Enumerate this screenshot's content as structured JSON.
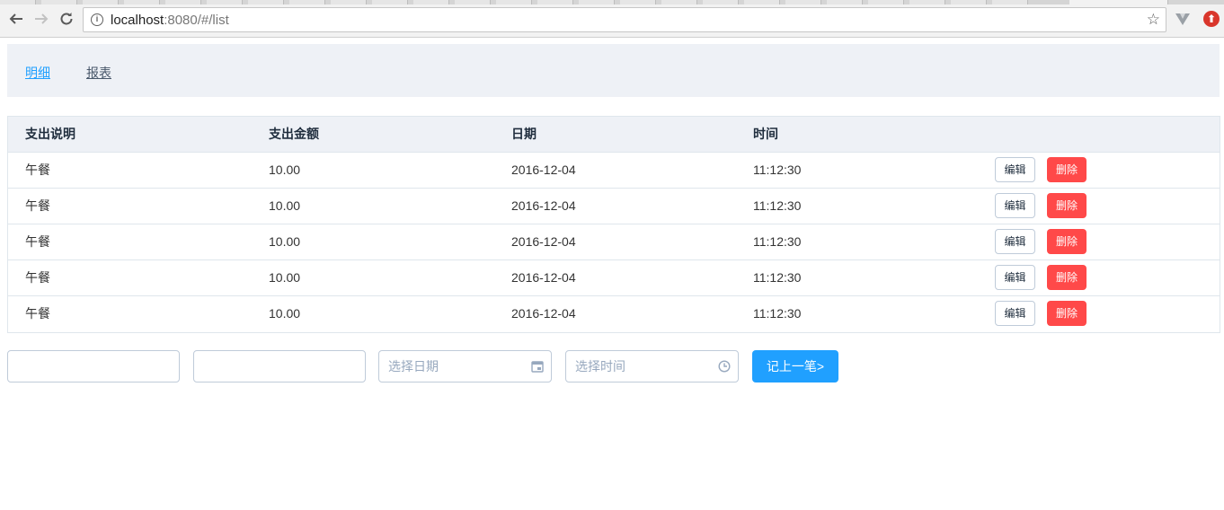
{
  "browser": {
    "url_host": "localhost",
    "url_rest": ":8080/#/list"
  },
  "nav": {
    "detail": "明细",
    "report": "报表"
  },
  "table": {
    "headers": [
      "支出说明",
      "支出金额",
      "日期",
      "时间"
    ],
    "rows": [
      {
        "desc": "午餐",
        "amount": "10.00",
        "date": "2016-12-04",
        "time": "11:12:30"
      },
      {
        "desc": "午餐",
        "amount": "10.00",
        "date": "2016-12-04",
        "time": "11:12:30"
      },
      {
        "desc": "午餐",
        "amount": "10.00",
        "date": "2016-12-04",
        "time": "11:12:30"
      },
      {
        "desc": "午餐",
        "amount": "10.00",
        "date": "2016-12-04",
        "time": "11:12:30"
      },
      {
        "desc": "午餐",
        "amount": "10.00",
        "date": "2016-12-04",
        "time": "11:12:30"
      }
    ],
    "edit_label": "编辑",
    "delete_label": "删除"
  },
  "form": {
    "desc_value": "",
    "amount_value": "",
    "date_placeholder": "选择日期",
    "time_placeholder": "选择时间",
    "submit_label": "记上一笔>"
  },
  "colors": {
    "primary": "#20a0ff",
    "danger": "#ff4949",
    "header_bg": "#eef1f6"
  }
}
